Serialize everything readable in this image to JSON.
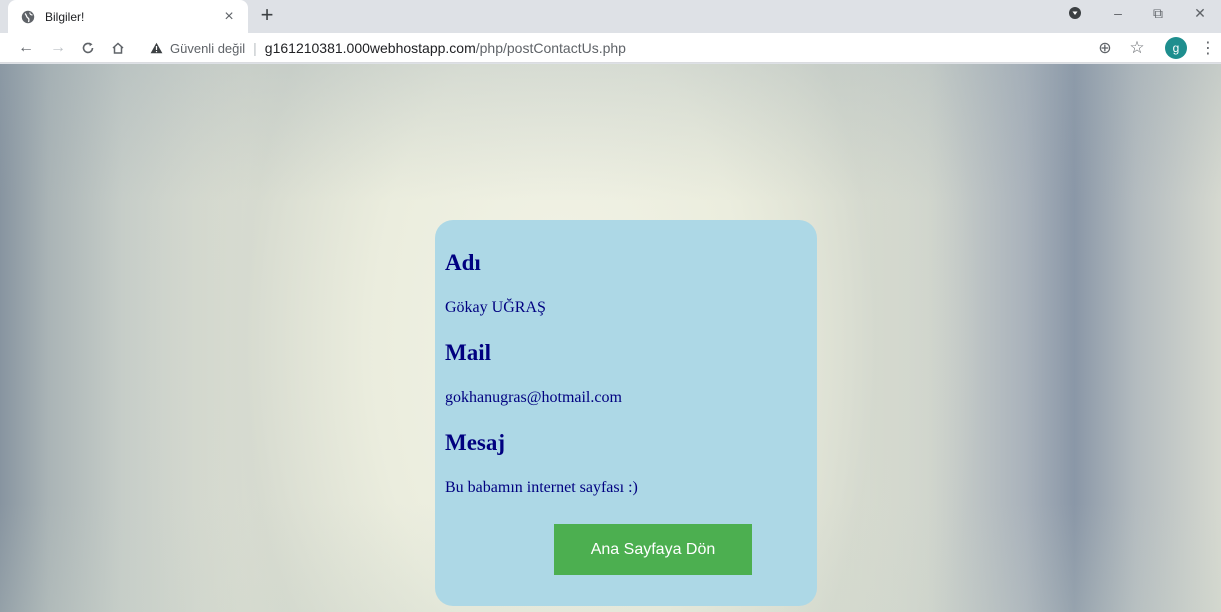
{
  "browser": {
    "tab": {
      "title": "Bilgiler!",
      "close_glyph": "×",
      "icon": "globe-icon"
    },
    "new_tab_glyph": "+",
    "window_controls": {
      "minimize": "–",
      "restore": "⧉",
      "close": "✕"
    },
    "toolbar": {
      "back": "←",
      "forward": "→",
      "reload": "C",
      "home": "⌂",
      "security_icon": "warning-icon",
      "security_label": "Güvenli değil",
      "divider": "|",
      "url_host": "g161210381.000webhostapp.com",
      "url_path": "/php/postContactUs.php",
      "zoom_icon": "⊕",
      "star_icon": "☆",
      "avatar_letter": "g",
      "menu_icon": "⋮",
      "accent_avatar": "#1e8e8e"
    }
  },
  "page": {
    "card_bg": "#add8e6",
    "text_color": "#000080",
    "fields": [
      {
        "label": "Adı",
        "value": "Gökay UĞRAŞ"
      },
      {
        "label": "Mail",
        "value": "gokhanugras@hotmail.com"
      },
      {
        "label": "Mesaj",
        "value": "Bu babamın internet sayfası :)"
      }
    ],
    "back_button_label": "Ana Sayfaya Dön",
    "button_color": "#4caf50"
  }
}
